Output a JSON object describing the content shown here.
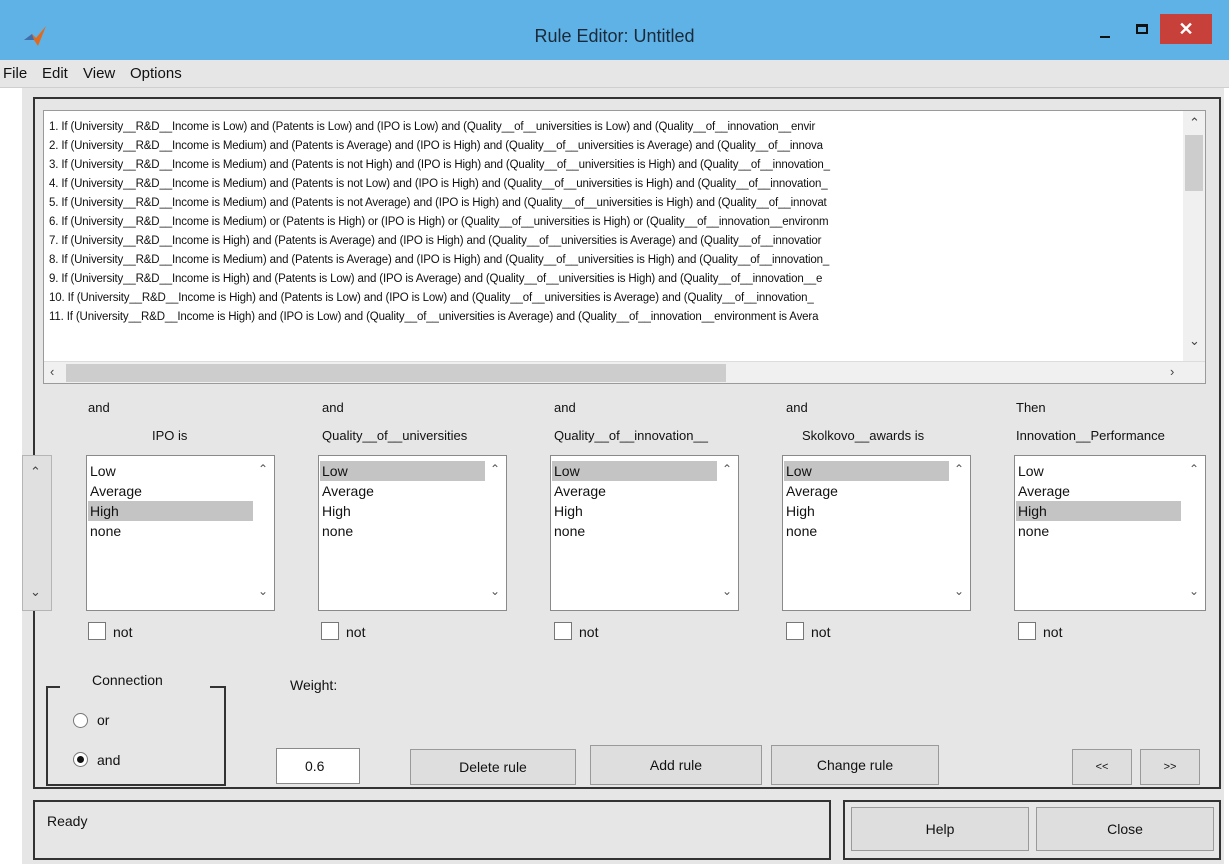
{
  "window": {
    "title": "Rule Editor: Untitled"
  },
  "menu": [
    "File",
    "Edit",
    "View",
    "Options"
  ],
  "rules": [
    "1. If (University__R&D__Income is Low) and (Patents is Low) and (IPO is Low) and (Quality__of__universities is Low) and (Quality__of__innovation__envir",
    "2. If (University__R&D__Income is Medium) and (Patents is Average) and (IPO is High) and (Quality__of__universities is Average) and (Quality__of__innova",
    "3. If (University__R&D__Income is Medium) and (Patents is not High) and (IPO is High) and (Quality__of__universities is High) and (Quality__of__innovation_",
    "4. If (University__R&D__Income is Medium) and (Patents is not Low) and (IPO is High) and (Quality__of__universities is High) and (Quality__of__innovation_",
    "5. If (University__R&D__Income is Medium) and (Patents is not Average) and (IPO is High) and (Quality__of__universities is High) and (Quality__of__innovat",
    "6. If (University__R&D__Income is Medium) or (Patents is High) or (IPO is High) or (Quality__of__universities is High) or (Quality__of__innovation__environm",
    "7. If (University__R&D__Income is High) and (Patents is Average) and (IPO is High) and (Quality__of__universities is Average) and (Quality__of__innovatior",
    "8. If (University__R&D__Income is Medium) and (Patents is Average) and (IPO is High) and (Quality__of__universities is High) and (Quality__of__innovation_",
    "9. If (University__R&D__Income is High) and (Patents is Low) and (IPO is Average) and (Quality__of__universities is High) and (Quality__of__innovation__e",
    "10. If (University__R&D__Income is High) and (Patents is Low) and (IPO is Low) and (Quality__of__universities is Average) and (Quality__of__innovation_",
    "11. If (University__R&D__Income is High) and (IPO is Low) and (Quality__of__universities is Average) and (Quality__of__innovation__environment is Avera"
  ],
  "columns": [
    {
      "connector": "and",
      "name": "IPO is",
      "options": [
        "Low",
        "Average",
        "High",
        "none"
      ],
      "selected": 2,
      "not_label": "not"
    },
    {
      "connector": "and",
      "name": "Quality__of__universities",
      "options": [
        "Low",
        "Average",
        "High",
        "none"
      ],
      "selected": 0,
      "not_label": "not"
    },
    {
      "connector": "and",
      "name": "Quality__of__innovation__",
      "options": [
        "Low",
        "Average",
        "High",
        "none"
      ],
      "selected": 0,
      "not_label": "not"
    },
    {
      "connector": "and",
      "name": "Skolkovo__awards is",
      "options": [
        "Low",
        "Average",
        "High",
        "none"
      ],
      "selected": 0,
      "not_label": "not"
    },
    {
      "connector": "Then",
      "name": "Innovation__Performance",
      "options": [
        "Low",
        "Average",
        "High",
        "none"
      ],
      "selected": 2,
      "not_label": "not"
    }
  ],
  "connection": {
    "label": "Connection",
    "options": [
      "or",
      "and"
    ],
    "selected": "and"
  },
  "weight": {
    "label": "Weight:",
    "value": "0.6"
  },
  "buttons": {
    "delete": "Delete rule",
    "add": "Add rule",
    "change": "Change rule",
    "prev": "<<",
    "next": ">>",
    "help": "Help",
    "close": "Close"
  },
  "status": "Ready"
}
